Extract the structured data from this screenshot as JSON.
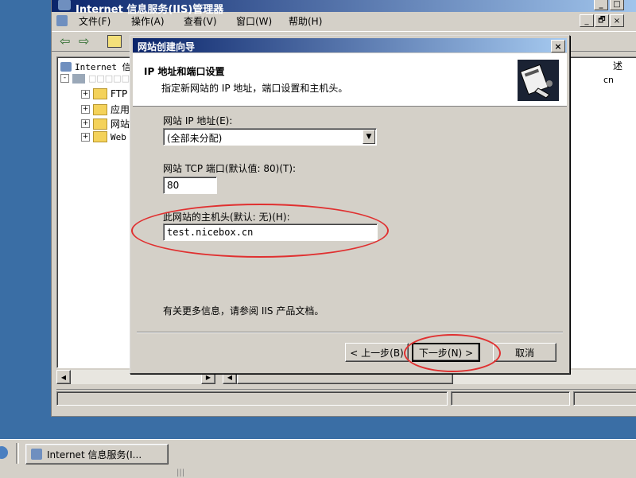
{
  "app": {
    "title": "Internet 信息服务(IIS)管理器",
    "title_controls": [
      "_",
      "□"
    ]
  },
  "menu": {
    "file": "文件(F)",
    "action": "操作(A)",
    "view": "查看(V)",
    "window": "窗口(W)",
    "help": "帮助(H)",
    "doc_controls": [
      "_",
      "🗗",
      "×"
    ]
  },
  "tree": {
    "root": "Internet 信",
    "server": "□□□□□□34",
    "items": [
      "FTP",
      "应用",
      "网站",
      "Web"
    ]
  },
  "right_pane": {
    "header_fragment": "述",
    "value_fragment": "cn"
  },
  "wizard": {
    "title": "网站创建向导",
    "close": "×",
    "header_title": "IP 地址和端口设置",
    "header_subtitle": "指定新网站的 IP 地址，端口设置和主机头。",
    "ip_label": "网站 IP 地址(E):",
    "ip_value": "(全部未分配)",
    "port_label": "网站 TCP 端口(默认值: 80)(T):",
    "port_value": "80",
    "host_label": "此网站的主机头(默认: 无)(H):",
    "host_value": "test.nicebox.cn",
    "info_text": "有关更多信息，请参阅 IIS 产品文档。",
    "back_button": "< 上一步(B)",
    "next_button": "下一步(N) >",
    "cancel_button": "取消"
  },
  "taskbar": {
    "task_label": "Internet 信息服务(I..."
  },
  "colors": {
    "desktop": "#3a6ea5",
    "titlebar_start": "#0a246a",
    "titlebar_end": "#a6caf0",
    "face": "#d4d0c8",
    "annotation": "#e03030"
  }
}
